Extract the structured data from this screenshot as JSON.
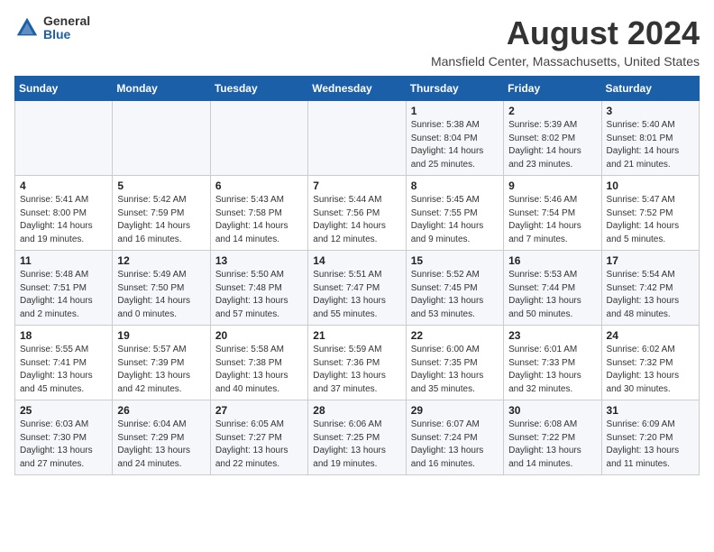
{
  "logo": {
    "general": "General",
    "blue": "Blue"
  },
  "title": "August 2024",
  "location": "Mansfield Center, Massachusetts, United States",
  "headers": [
    "Sunday",
    "Monday",
    "Tuesday",
    "Wednesday",
    "Thursday",
    "Friday",
    "Saturday"
  ],
  "weeks": [
    [
      {
        "day": "",
        "info": ""
      },
      {
        "day": "",
        "info": ""
      },
      {
        "day": "",
        "info": ""
      },
      {
        "day": "",
        "info": ""
      },
      {
        "day": "1",
        "info": "Sunrise: 5:38 AM\nSunset: 8:04 PM\nDaylight: 14 hours and 25 minutes."
      },
      {
        "day": "2",
        "info": "Sunrise: 5:39 AM\nSunset: 8:02 PM\nDaylight: 14 hours and 23 minutes."
      },
      {
        "day": "3",
        "info": "Sunrise: 5:40 AM\nSunset: 8:01 PM\nDaylight: 14 hours and 21 minutes."
      }
    ],
    [
      {
        "day": "4",
        "info": "Sunrise: 5:41 AM\nSunset: 8:00 PM\nDaylight: 14 hours and 19 minutes."
      },
      {
        "day": "5",
        "info": "Sunrise: 5:42 AM\nSunset: 7:59 PM\nDaylight: 14 hours and 16 minutes."
      },
      {
        "day": "6",
        "info": "Sunrise: 5:43 AM\nSunset: 7:58 PM\nDaylight: 14 hours and 14 minutes."
      },
      {
        "day": "7",
        "info": "Sunrise: 5:44 AM\nSunset: 7:56 PM\nDaylight: 14 hours and 12 minutes."
      },
      {
        "day": "8",
        "info": "Sunrise: 5:45 AM\nSunset: 7:55 PM\nDaylight: 14 hours and 9 minutes."
      },
      {
        "day": "9",
        "info": "Sunrise: 5:46 AM\nSunset: 7:54 PM\nDaylight: 14 hours and 7 minutes."
      },
      {
        "day": "10",
        "info": "Sunrise: 5:47 AM\nSunset: 7:52 PM\nDaylight: 14 hours and 5 minutes."
      }
    ],
    [
      {
        "day": "11",
        "info": "Sunrise: 5:48 AM\nSunset: 7:51 PM\nDaylight: 14 hours and 2 minutes."
      },
      {
        "day": "12",
        "info": "Sunrise: 5:49 AM\nSunset: 7:50 PM\nDaylight: 14 hours and 0 minutes."
      },
      {
        "day": "13",
        "info": "Sunrise: 5:50 AM\nSunset: 7:48 PM\nDaylight: 13 hours and 57 minutes."
      },
      {
        "day": "14",
        "info": "Sunrise: 5:51 AM\nSunset: 7:47 PM\nDaylight: 13 hours and 55 minutes."
      },
      {
        "day": "15",
        "info": "Sunrise: 5:52 AM\nSunset: 7:45 PM\nDaylight: 13 hours and 53 minutes."
      },
      {
        "day": "16",
        "info": "Sunrise: 5:53 AM\nSunset: 7:44 PM\nDaylight: 13 hours and 50 minutes."
      },
      {
        "day": "17",
        "info": "Sunrise: 5:54 AM\nSunset: 7:42 PM\nDaylight: 13 hours and 48 minutes."
      }
    ],
    [
      {
        "day": "18",
        "info": "Sunrise: 5:55 AM\nSunset: 7:41 PM\nDaylight: 13 hours and 45 minutes."
      },
      {
        "day": "19",
        "info": "Sunrise: 5:57 AM\nSunset: 7:39 PM\nDaylight: 13 hours and 42 minutes."
      },
      {
        "day": "20",
        "info": "Sunrise: 5:58 AM\nSunset: 7:38 PM\nDaylight: 13 hours and 40 minutes."
      },
      {
        "day": "21",
        "info": "Sunrise: 5:59 AM\nSunset: 7:36 PM\nDaylight: 13 hours and 37 minutes."
      },
      {
        "day": "22",
        "info": "Sunrise: 6:00 AM\nSunset: 7:35 PM\nDaylight: 13 hours and 35 minutes."
      },
      {
        "day": "23",
        "info": "Sunrise: 6:01 AM\nSunset: 7:33 PM\nDaylight: 13 hours and 32 minutes."
      },
      {
        "day": "24",
        "info": "Sunrise: 6:02 AM\nSunset: 7:32 PM\nDaylight: 13 hours and 30 minutes."
      }
    ],
    [
      {
        "day": "25",
        "info": "Sunrise: 6:03 AM\nSunset: 7:30 PM\nDaylight: 13 hours and 27 minutes."
      },
      {
        "day": "26",
        "info": "Sunrise: 6:04 AM\nSunset: 7:29 PM\nDaylight: 13 hours and 24 minutes."
      },
      {
        "day": "27",
        "info": "Sunrise: 6:05 AM\nSunset: 7:27 PM\nDaylight: 13 hours and 22 minutes."
      },
      {
        "day": "28",
        "info": "Sunrise: 6:06 AM\nSunset: 7:25 PM\nDaylight: 13 hours and 19 minutes."
      },
      {
        "day": "29",
        "info": "Sunrise: 6:07 AM\nSunset: 7:24 PM\nDaylight: 13 hours and 16 minutes."
      },
      {
        "day": "30",
        "info": "Sunrise: 6:08 AM\nSunset: 7:22 PM\nDaylight: 13 hours and 14 minutes."
      },
      {
        "day": "31",
        "info": "Sunrise: 6:09 AM\nSunset: 7:20 PM\nDaylight: 13 hours and 11 minutes."
      }
    ]
  ]
}
